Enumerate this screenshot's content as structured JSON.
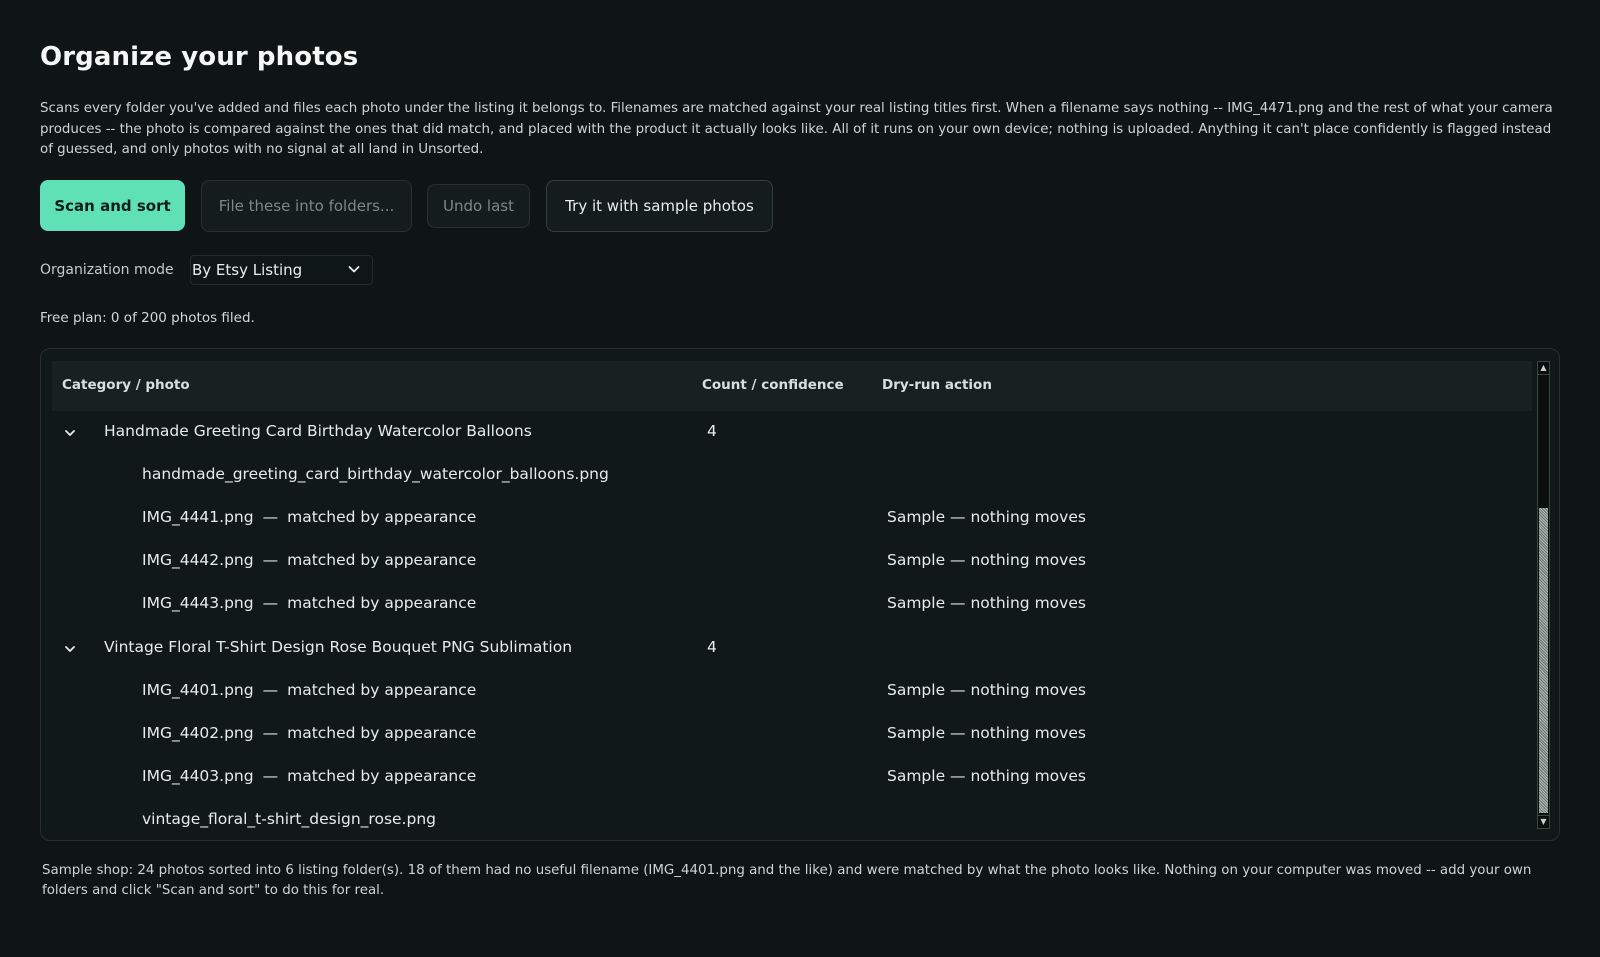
{
  "page": {
    "title": "Organize your photos",
    "description": "Scans every folder you've added and files each photo under the listing it belongs to. Filenames are matched against your real listing titles first. When a filename says nothing -- IMG_4471.png and the rest of what your camera produces -- the photo is compared against the ones that did match, and placed with the product it actually looks like. All of it runs on your own device; nothing is uploaded. Anything it can't place confidently is flagged instead of guessed, and only photos with no signal at all land in Unsorted."
  },
  "actions": {
    "scan_label": "Scan and sort",
    "file_label": "File these into folders...",
    "undo_label": "Undo last",
    "sample_label": "Try it with sample photos"
  },
  "mode": {
    "label": "Organization mode",
    "selected": "By Etsy Listing"
  },
  "plan": {
    "text": "Free plan: 0 of 200 photos filed."
  },
  "tree": {
    "headers": {
      "category": "Category / photo",
      "count": "Count / confidence",
      "action": "Dry-run action"
    },
    "categories": [
      {
        "name": "Handmade Greeting Card Birthday Watercolor Balloons",
        "count": "4",
        "photos": [
          {
            "name": "handmade_greeting_card_birthday_watercolor_balloons.png",
            "match": "",
            "action": ""
          },
          {
            "name": "IMG_4441.png",
            "match": "matched by appearance",
            "action": "Sample — nothing moves"
          },
          {
            "name": "IMG_4442.png",
            "match": "matched by appearance",
            "action": "Sample — nothing moves"
          },
          {
            "name": "IMG_4443.png",
            "match": "matched by appearance",
            "action": "Sample — nothing moves"
          }
        ]
      },
      {
        "name": "Vintage Floral T-Shirt Design Rose Bouquet PNG Sublimation",
        "count": "4",
        "photos": [
          {
            "name": "IMG_4401.png",
            "match": "matched by appearance",
            "action": "Sample — nothing moves"
          },
          {
            "name": "IMG_4402.png",
            "match": "matched by appearance",
            "action": "Sample — nothing moves"
          },
          {
            "name": "IMG_4403.png",
            "match": "matched by appearance",
            "action": "Sample — nothing moves"
          },
          {
            "name": "vintage_floral_t-shirt_design_rose.png",
            "match": "",
            "action": ""
          }
        ]
      }
    ],
    "separator": "—"
  },
  "footer": {
    "text": "Sample shop: 24 photos sorted into 6 listing folder(s). 18 of them had no useful filename (IMG_4401.png and the like) and were matched by what the photo looks like. Nothing on your computer was moved -- add your own folders and click \"Scan and sort\" to do this for real."
  },
  "colors": {
    "background": "#0e1514",
    "accent": "#5fe0b5",
    "panel": "#101918",
    "header": "#172220"
  }
}
